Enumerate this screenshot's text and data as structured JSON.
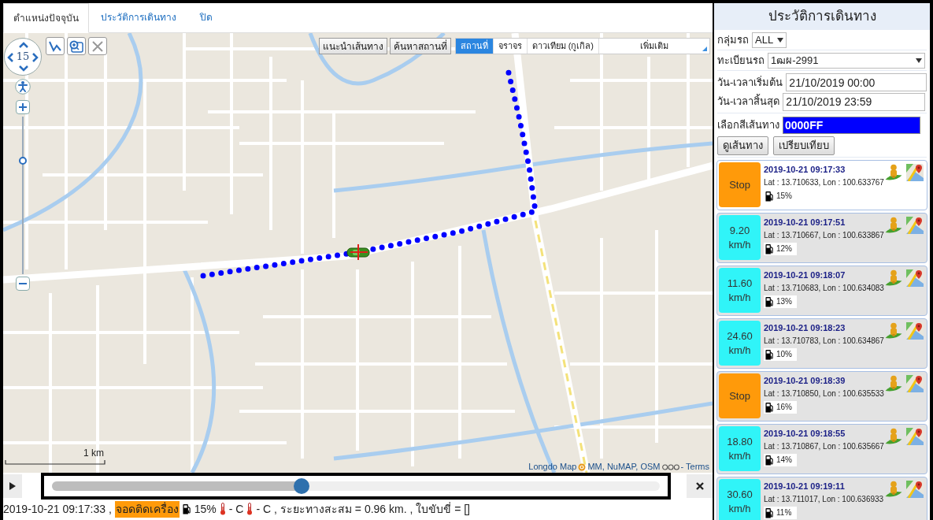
{
  "tabs": [
    {
      "label": "ตำแหน่งปัจจุบัน",
      "selected": true
    },
    {
      "label": "ประวัติการเดินทาง",
      "selected": false
    },
    {
      "label": "ปิด",
      "selected": false
    }
  ],
  "map": {
    "zoom": "15",
    "zoom_slider": {
      "level": 0.73
    },
    "tool_buttons": [
      "แนะนำเส้นทาง",
      "ค้นหาสถานที่"
    ],
    "layer_tabs": [
      {
        "label": "สถานที่",
        "selected": true
      },
      {
        "label": "จราจร",
        "selected": false
      },
      {
        "label": "ดาวเทียม (กูเกิล)",
        "selected": false
      }
    ],
    "more_menu": "เพิ่มเติม",
    "scale": "1 km",
    "attribution": {
      "source": "Longdo Map",
      "credits": "MM, NuMAP, OSM",
      "link": "- Terms"
    }
  },
  "playback": {
    "level": 0.41
  },
  "status": {
    "timestamp": "2019-10-21 09:17:33 ,",
    "engine_state": "จอดติดเครื่อง",
    "fuel": "15%",
    "sensors": [
      "- C",
      "- C ,"
    ],
    "summary": "ระยะทางสะสม = 0.96 km. , ใบขับขี่ = []"
  },
  "panel": {
    "title": "ประวัติการเดินทาง",
    "group": {
      "label": "กลุ่มรถ",
      "value": "ALL"
    },
    "plate": {
      "label": "ทะเบียนรถ",
      "value": "1ฒผ-2991"
    },
    "start": {
      "label": "วัน-เวลาเริ่มต้น",
      "value": "21/10/2019 00:00"
    },
    "end": {
      "label": "วัน-เวลาสิ้นสุด",
      "value": "21/10/2019 23:59"
    },
    "route_color": {
      "label": "เลือกสีเส้นทาง",
      "value": "0000FF",
      "color": "#0000ff"
    },
    "buttons": [
      "ดูเส้นทาง",
      "เปรียบเทียบ"
    ]
  },
  "records": [
    {
      "kind": "stop",
      "speed": "Stop",
      "time": "2019-10-21 09:17:33",
      "position": "Lat : 13.710633, Lon : 100.633767",
      "fuel": "15%",
      "selected": true
    },
    {
      "kind": "moving",
      "speed": "9.20",
      "unit": "km/h",
      "time": "2019-10-21 09:17:51",
      "position": "Lat : 13.710667, Lon : 100.633867",
      "fuel": "12%",
      "selected": false
    },
    {
      "kind": "moving",
      "speed": "11.60",
      "unit": "km/h",
      "time": "2019-10-21 09:18:07",
      "position": "Lat : 13.710683, Lon : 100.634083",
      "fuel": "13%",
      "selected": false
    },
    {
      "kind": "moving",
      "speed": "24.60",
      "unit": "km/h",
      "time": "2019-10-21 09:18:23",
      "position": "Lat : 13.710783, Lon : 100.634867",
      "fuel": "10%",
      "selected": false
    },
    {
      "kind": "stop",
      "speed": "Stop",
      "time": "2019-10-21 09:18:39",
      "position": "Lat : 13.710850, Lon : 100.635533",
      "fuel": "16%",
      "selected": false
    },
    {
      "kind": "moving",
      "speed": "18.80",
      "unit": "km/h",
      "time": "2019-10-21 09:18:55",
      "position": "Lat : 13.710867, Lon : 100.635667",
      "fuel": "14%",
      "selected": false
    },
    {
      "kind": "moving",
      "speed": "30.60",
      "unit": "km/h",
      "time": "2019-10-21 09:19:11",
      "position": "Lat : 13.711017, Lon : 100.636933",
      "fuel": "11%",
      "selected": false
    }
  ]
}
